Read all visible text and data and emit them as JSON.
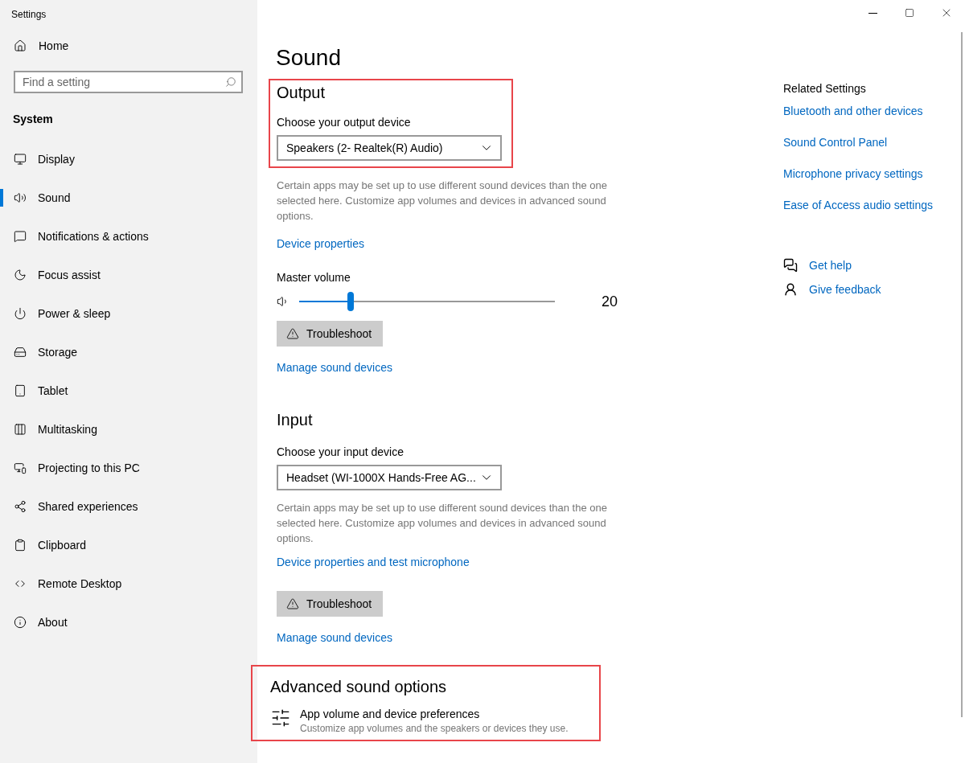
{
  "window": {
    "title": "Settings"
  },
  "sidebar": {
    "home": "Home",
    "search": {
      "placeholder": "Find a setting"
    },
    "section": "System",
    "items": [
      {
        "label": "Display",
        "selected": false
      },
      {
        "label": "Sound",
        "selected": true
      },
      {
        "label": "Notifications & actions",
        "selected": false
      },
      {
        "label": "Focus assist",
        "selected": false
      },
      {
        "label": "Power & sleep",
        "selected": false
      },
      {
        "label": "Storage",
        "selected": false
      },
      {
        "label": "Tablet",
        "selected": false
      },
      {
        "label": "Multitasking",
        "selected": false
      },
      {
        "label": "Projecting to this PC",
        "selected": false
      },
      {
        "label": "Shared experiences",
        "selected": false
      },
      {
        "label": "Clipboard",
        "selected": false
      },
      {
        "label": "Remote Desktop",
        "selected": false
      },
      {
        "label": "About",
        "selected": false
      }
    ]
  },
  "page_title": "Sound",
  "output": {
    "heading": "Output",
    "device_label": "Choose your output device",
    "device": "Speakers (2- Realtek(R) Audio)",
    "description": "Certain apps may be set up to use different sound devices than the one selected here. Customize app volumes and devices in advanced sound options.",
    "properties_link": "Device properties",
    "volume_label": "Master volume",
    "volume": {
      "level": 0.2,
      "reading": "20"
    },
    "troubleshoot": "Troubleshoot",
    "manage_link": "Manage sound devices"
  },
  "input": {
    "heading": "Input",
    "device_label": "Choose your input device",
    "device": "Headset (WI-1000X Hands-Free AG...",
    "description": "Certain apps may be set up to use different sound devices than the one selected here. Customize app volumes and devices in advanced sound options.",
    "properties_link": "Device properties and test microphone",
    "troubleshoot": "Troubleshoot",
    "manage_link": "Manage sound devices"
  },
  "advanced": {
    "heading": "Advanced sound options",
    "item": {
      "title": "App volume and device preferences",
      "subtitle": "Customize app volumes and the speakers or devices they use."
    }
  },
  "related": {
    "heading": "Related Settings",
    "links": [
      "Bluetooth and other devices",
      "Sound Control Panel",
      "Microphone privacy settings",
      "Ease of Access audio settings"
    ]
  },
  "help": {
    "get_help": "Get help",
    "feedback": "Give feedback"
  }
}
